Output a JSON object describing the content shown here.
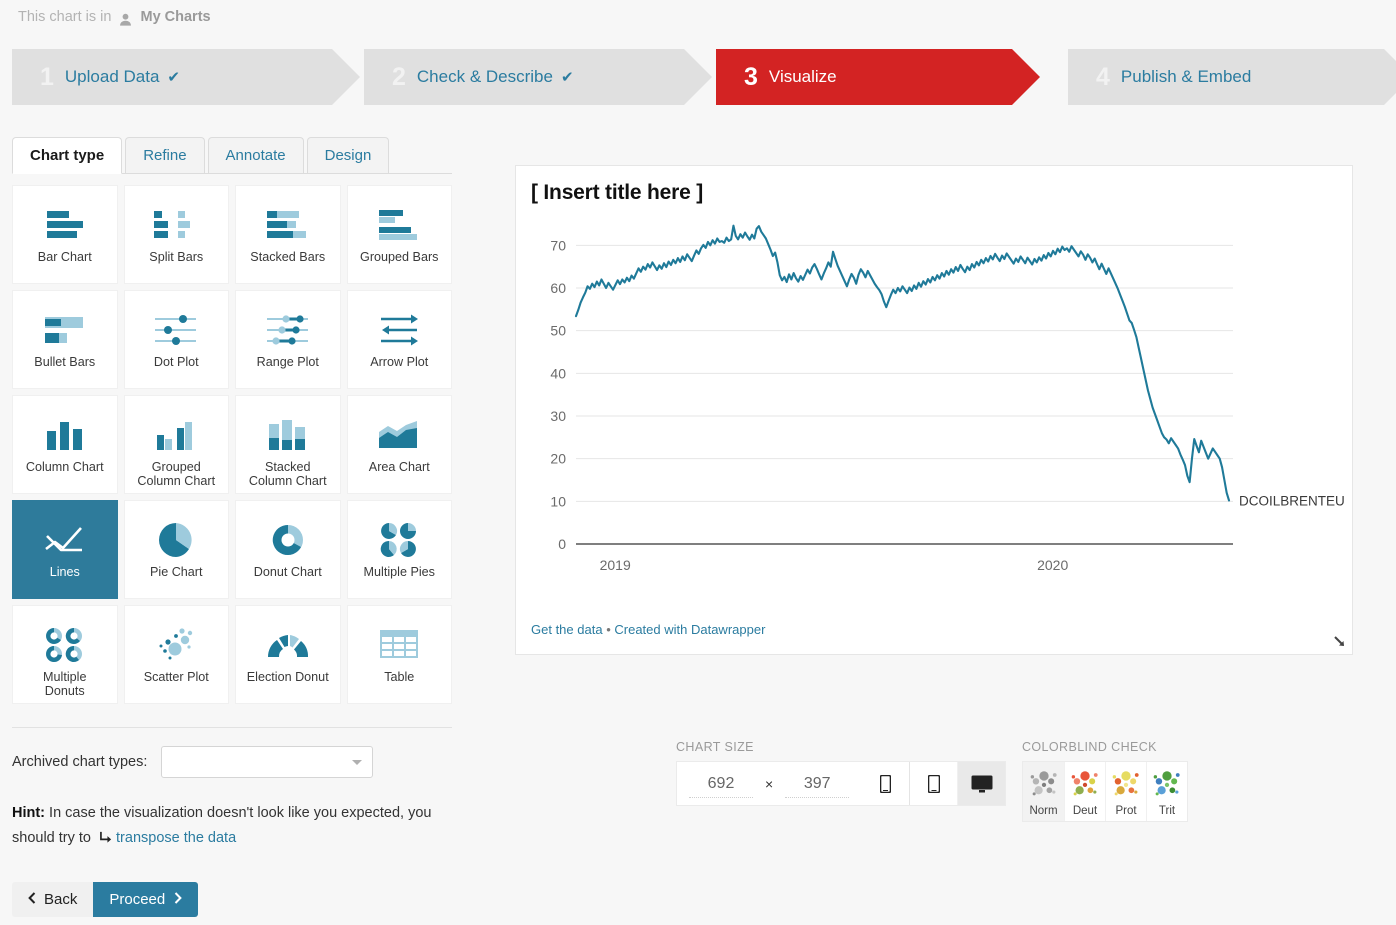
{
  "breadcrumb": {
    "prefix": "This chart is in",
    "folder": "My Charts",
    "user_icon": "user-icon"
  },
  "steps": [
    {
      "num": "1",
      "label": "Upload Data",
      "check": "✔",
      "active": false
    },
    {
      "num": "2",
      "label": "Check & Describe",
      "check": "✔",
      "active": false
    },
    {
      "num": "3",
      "label": "Visualize",
      "check": "",
      "active": true
    },
    {
      "num": "4",
      "label": "Publish & Embed",
      "check": "",
      "active": false
    }
  ],
  "tabs": [
    {
      "label": "Chart type",
      "active": true
    },
    {
      "label": "Refine",
      "active": false
    },
    {
      "label": "Annotate",
      "active": false
    },
    {
      "label": "Design",
      "active": false
    }
  ],
  "chart_types": [
    {
      "label": "Bar Chart",
      "icon": "bar-chart-icon",
      "selected": false
    },
    {
      "label": "Split Bars",
      "icon": "split-bars-icon",
      "selected": false
    },
    {
      "label": "Stacked Bars",
      "icon": "stacked-bars-icon",
      "selected": false
    },
    {
      "label": "Grouped Bars",
      "icon": "grouped-bars-icon",
      "selected": false
    },
    {
      "label": "Bullet Bars",
      "icon": "bullet-bars-icon",
      "selected": false
    },
    {
      "label": "Dot Plot",
      "icon": "dot-plot-icon",
      "selected": false
    },
    {
      "label": "Range Plot",
      "icon": "range-plot-icon",
      "selected": false
    },
    {
      "label": "Arrow Plot",
      "icon": "arrow-plot-icon",
      "selected": false
    },
    {
      "label": "Column Chart",
      "icon": "column-chart-icon",
      "selected": false
    },
    {
      "label": "Grouped\nColumn Chart",
      "icon": "grouped-column-chart-icon",
      "selected": false
    },
    {
      "label": "Stacked\nColumn Chart",
      "icon": "stacked-column-chart-icon",
      "selected": false
    },
    {
      "label": "Area Chart",
      "icon": "area-chart-icon",
      "selected": false
    },
    {
      "label": "Lines",
      "icon": "lines-icon",
      "selected": true
    },
    {
      "label": "Pie Chart",
      "icon": "pie-chart-icon",
      "selected": false
    },
    {
      "label": "Donut Chart",
      "icon": "donut-chart-icon",
      "selected": false
    },
    {
      "label": "Multiple Pies",
      "icon": "multiple-pies-icon",
      "selected": false
    },
    {
      "label": "Multiple\nDonuts",
      "icon": "multiple-donuts-icon",
      "selected": false
    },
    {
      "label": "Scatter Plot",
      "icon": "scatter-plot-icon",
      "selected": false
    },
    {
      "label": "Election Donut",
      "icon": "election-donut-icon",
      "selected": false
    },
    {
      "label": "Table",
      "icon": "table-icon",
      "selected": false
    }
  ],
  "archived": {
    "label": "Archived chart types:",
    "value": "",
    "caret_icon": "chevron-down-icon"
  },
  "hint": {
    "prefix": "Hint:",
    "text_1": "In case the visualization doesn't look like you expected, you should try to",
    "icon": "transpose-icon",
    "link": "transpose the data"
  },
  "buttons": {
    "back": "Back",
    "back_icon": "chevron-left-icon",
    "proceed": "Proceed",
    "proceed_icon": "chevron-right-icon"
  },
  "preview": {
    "footer_get_data": "Get the data",
    "footer_sep": "•",
    "footer_created": "Created with Datawrapper",
    "resize_icon": "resize-handle-icon"
  },
  "chart_size": {
    "caption": "CHART SIZE",
    "width": "692",
    "times": "×",
    "height": "397",
    "modes": [
      {
        "icon": "mobile-portrait-icon",
        "active": false
      },
      {
        "icon": "tablet-icon",
        "active": false
      },
      {
        "icon": "desktop-icon",
        "active": true
      }
    ]
  },
  "colorblind_check": {
    "caption": "COLORBLIND CHECK",
    "items": [
      {
        "label": "Norm",
        "icon": "colorblind-norm-icon",
        "active": true
      },
      {
        "label": "Deut",
        "icon": "colorblind-deut-icon",
        "active": false
      },
      {
        "label": "Prot",
        "icon": "colorblind-prot-icon",
        "active": false
      },
      {
        "label": "Trit",
        "icon": "colorblind-trit-icon",
        "active": false
      }
    ]
  },
  "colors": {
    "accent_teal": "#2b7ca0",
    "line_color": "#1f7a99",
    "active_step_red": "#d32323",
    "selected_tile": "#2e7b9b",
    "icon_dark": "#1f7a99",
    "icon_light": "#9ecbdd"
  },
  "chart_data": {
    "type": "line",
    "title": "[ Insert title here ]",
    "xlabel": "",
    "ylabel": "",
    "ylim": [
      0,
      75
    ],
    "yticks": [
      0,
      10,
      20,
      30,
      40,
      50,
      60,
      70
    ],
    "xticks": [
      "2019",
      "2020"
    ],
    "xtick_positions": [
      0.06,
      0.73
    ],
    "grid": true,
    "legend_position": "right-end-label",
    "series": [
      {
        "name": "DCOILBRENTEU",
        "color": "#1f7a99",
        "values": [
          53.4,
          54.9,
          56.6,
          57.8,
          58.9,
          60.4,
          59.8,
          61.0,
          60.2,
          61.5,
          60.6,
          62.0,
          61.0,
          60.0,
          61.2,
          60.4,
          59.6,
          60.7,
          61.8,
          60.9,
          62.0,
          61.3,
          62.4,
          61.6,
          62.9,
          62.2,
          63.4,
          64.6,
          63.8,
          65.0,
          64.3,
          65.6,
          64.8,
          66.0,
          65.1,
          64.2,
          65.3,
          64.5,
          65.8,
          64.9,
          66.2,
          65.4,
          66.6,
          65.8,
          67.0,
          66.1,
          67.4,
          66.5,
          67.9,
          67.1,
          66.3,
          67.6,
          68.8,
          68.0,
          69.3,
          70.1,
          69.4,
          70.8,
          70.0,
          71.2,
          70.4,
          71.6,
          70.8,
          71.0,
          70.6,
          71.8,
          71.0,
          71.4,
          74.6,
          72.2,
          71.4,
          72.6,
          71.8,
          73.0,
          72.1,
          71.3,
          72.5,
          71.6,
          73.9,
          74.5,
          73.2,
          72.4,
          71.6,
          70.3,
          69.0,
          67.5,
          68.3,
          66.0,
          63.0,
          61.8,
          62.6,
          61.4,
          63.2,
          62.0,
          63.5,
          62.3,
          61.5,
          62.8,
          61.9,
          63.1,
          64.3,
          63.4,
          64.8,
          65.6,
          64.5,
          63.2,
          62.0,
          63.4,
          64.6,
          66.0,
          65.0,
          68.5,
          66.8,
          65.2,
          64.0,
          62.8,
          61.6,
          60.4,
          62.0,
          63.3,
          62.4,
          61.0,
          63.1,
          64.4,
          63.6,
          62.5,
          64.0,
          63.0,
          62.0,
          61.0,
          60.2,
          59.5,
          58.5,
          56.8,
          55.5,
          57.0,
          58.4,
          59.6,
          58.8,
          60.0,
          59.2,
          60.4,
          59.6,
          58.8,
          60.1,
          59.3,
          60.6,
          59.8,
          61.2,
          60.3,
          61.6,
          60.8,
          62.1,
          61.3,
          62.6,
          61.8,
          63.0,
          62.2,
          63.5,
          62.7,
          64.0,
          63.1,
          64.4,
          63.6,
          64.9,
          64.0,
          65.4,
          64.5,
          63.7,
          65.0,
          64.2,
          65.6,
          64.8,
          66.1,
          65.3,
          66.6,
          65.8,
          67.0,
          66.2,
          67.5,
          66.7,
          68.0,
          67.1,
          66.3,
          67.6,
          66.8,
          68.1,
          67.3,
          66.5,
          65.7,
          66.9,
          66.1,
          67.4,
          66.6,
          65.8,
          67.1,
          66.3,
          65.5,
          66.8,
          66.0,
          67.2,
          66.4,
          67.7,
          66.9,
          68.2,
          67.4,
          68.7,
          67.9,
          69.2,
          68.4,
          69.7,
          68.9,
          69.3,
          68.5,
          69.8,
          69.0,
          68.2,
          67.4,
          68.6,
          67.8,
          66.6,
          67.9,
          67.1,
          66.0,
          66.9,
          65.6,
          64.4,
          65.7,
          64.5,
          63.3,
          64.6,
          63.4,
          62.2,
          61.0,
          59.8,
          58.4,
          57.0,
          55.6,
          54.0,
          52.4,
          51.8,
          50.2,
          48.5,
          46.0,
          43.5,
          41.0,
          38.5,
          36.0,
          34.0,
          32.0,
          30.5,
          29.0,
          27.5,
          26.0,
          25.0,
          24.5,
          23.6,
          24.8,
          24.0,
          23.2,
          22.4,
          21.0,
          19.8,
          18.5,
          16.0,
          14.5,
          20.0,
          24.6,
          23.0,
          21.5,
          24.2,
          22.8,
          21.4,
          20.0,
          21.2,
          22.4,
          21.6,
          20.8,
          20.0,
          18.0,
          15.0,
          12.0,
          10.2
        ]
      }
    ]
  }
}
